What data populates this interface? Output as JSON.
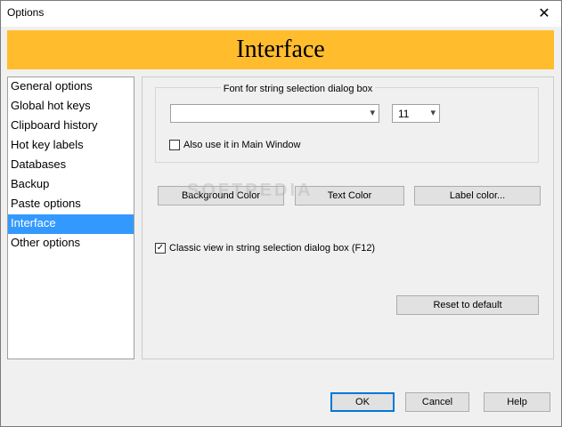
{
  "window": {
    "title": "Options"
  },
  "banner": {
    "heading": "Interface"
  },
  "sidebar": {
    "items": [
      {
        "label": "General options"
      },
      {
        "label": "Global hot keys"
      },
      {
        "label": "Clipboard history"
      },
      {
        "label": "Hot key labels"
      },
      {
        "label": "Databases"
      },
      {
        "label": "Backup"
      },
      {
        "label": "Paste options"
      },
      {
        "label": "Interface",
        "selected": true
      },
      {
        "label": "Other options"
      }
    ]
  },
  "font_group": {
    "label": "Font for string selection dialog box",
    "font_name": "",
    "font_size": "11",
    "main_window_checkbox": {
      "label": "Also use it in Main Window",
      "checked": false
    }
  },
  "color_buttons": {
    "background": "Background Color",
    "text": "Text Color",
    "label": "Label color..."
  },
  "classic_view": {
    "label": "Classic view in string selection dialog box (F12)",
    "checked": true
  },
  "reset_button": "Reset to default",
  "footer": {
    "ok": "OK",
    "cancel": "Cancel",
    "help": "Help"
  },
  "watermark": "SOFTPEDIA",
  "colors": {
    "banner": "#ffbd2e",
    "selection": "#3399ff",
    "dialog": "#f0f0f0"
  }
}
